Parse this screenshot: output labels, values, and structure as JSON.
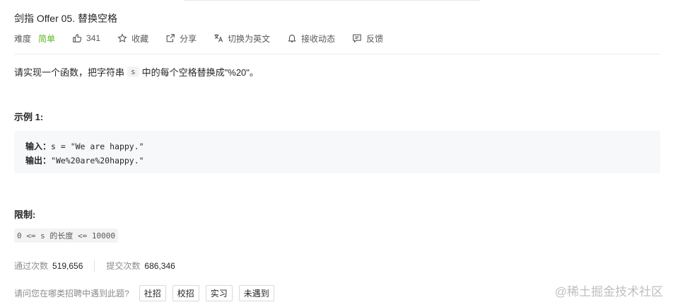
{
  "title": "剑指 Offer 05. 替换空格",
  "meta": {
    "difficulty_label": "难度",
    "difficulty_value": "简单",
    "likes": "341",
    "favorite": "收藏",
    "share": "分享",
    "switch_lang": "切换为英文",
    "subscribe": "接收动态",
    "feedback": "反馈"
  },
  "description": {
    "before": "请实现一个函数，把字符串",
    "code": "s",
    "after": "中的每个空格替换成\"%20\"。"
  },
  "example": {
    "title": "示例 1:",
    "input_label": "输入：",
    "input_value": "s = \"We are happy.\"",
    "output_label": "输出：",
    "output_value": "\"We%20are%20happy.\""
  },
  "limits": {
    "title": "限制:",
    "code": "0 <= s 的长度 <= 10000"
  },
  "stats": {
    "accepted_label": "通过次数",
    "accepted_value": "519,656",
    "submitted_label": "提交次数",
    "submitted_value": "686,346"
  },
  "survey": {
    "question": "请问您在哪类招聘中遇到此题?",
    "options": [
      "社招",
      "校招",
      "实习",
      "未遇到"
    ]
  },
  "watermark": "@稀土掘金技术社区",
  "colors": {
    "easy": "#5ab726",
    "muted": "#8c8c8c"
  }
}
